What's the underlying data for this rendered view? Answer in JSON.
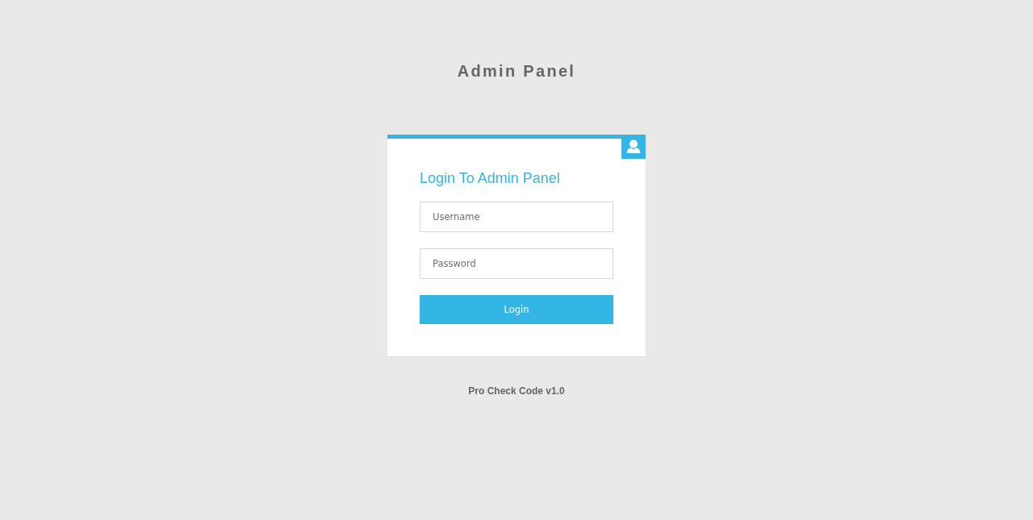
{
  "page": {
    "title": "Admin Panel"
  },
  "login_card": {
    "heading": "Login To Admin Panel",
    "fields": [
      {
        "placeholder": "Username"
      },
      {
        "placeholder": "Password"
      }
    ],
    "button": "Login"
  },
  "footer": "Pro Check Code v1.0"
}
